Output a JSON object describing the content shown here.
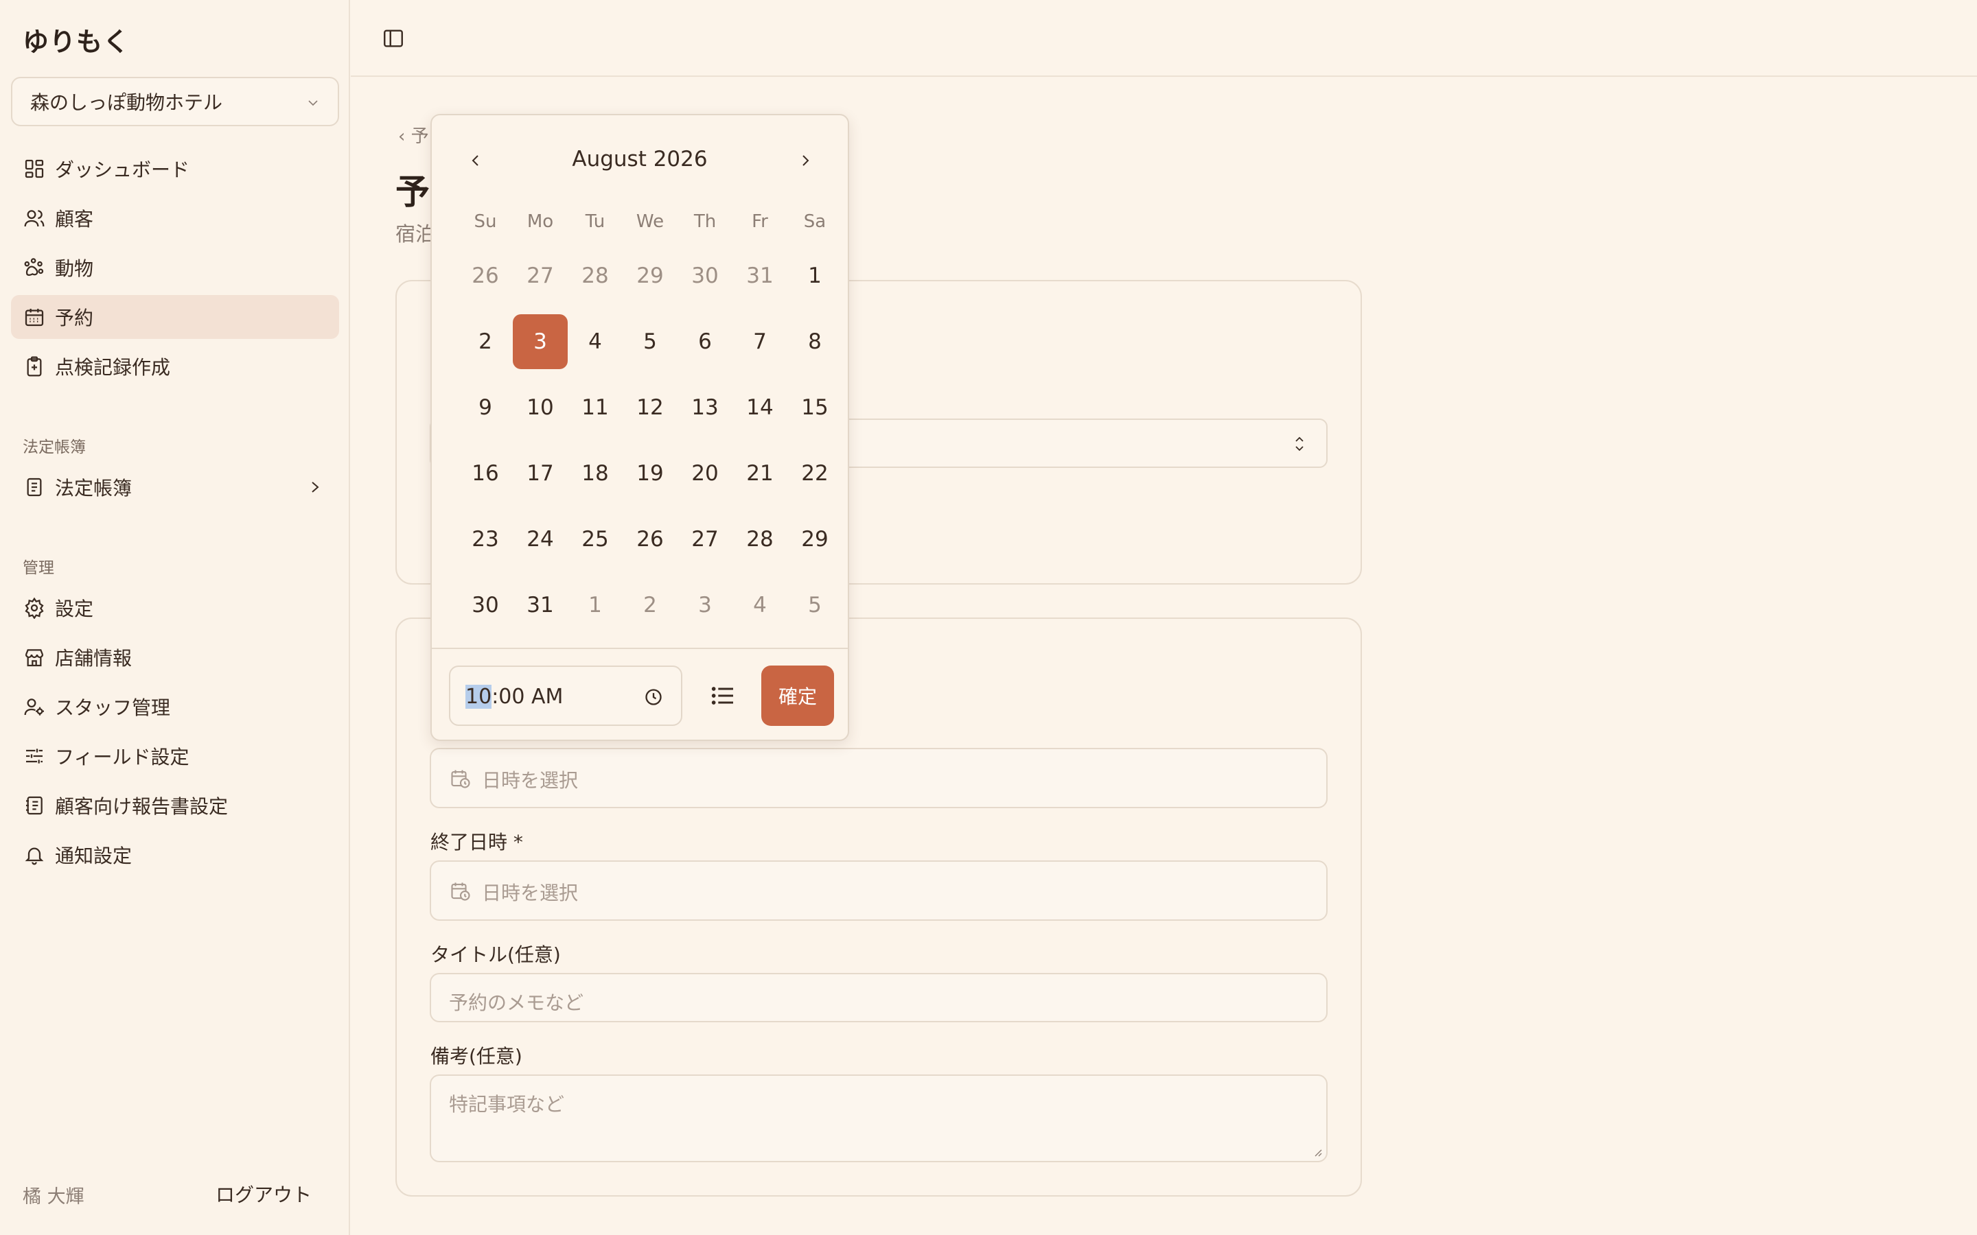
{
  "app": {
    "brand": "ゆりもく"
  },
  "store": {
    "selected": "森のしっぽ動物ホテル"
  },
  "nav": {
    "main": [
      {
        "label": "ダッシュボード",
        "icon": "dashboard-icon"
      },
      {
        "label": "顧客",
        "icon": "users-icon"
      },
      {
        "label": "動物",
        "icon": "paw-icon"
      },
      {
        "label": "予約",
        "icon": "calendar-icon",
        "active": true
      },
      {
        "label": "点検記録作成",
        "icon": "clipboard-icon"
      }
    ],
    "legal_section": "法定帳簿",
    "legal_item": "法定帳簿",
    "admin_section": "管理",
    "admin": [
      {
        "label": "設定",
        "icon": "gear-icon"
      },
      {
        "label": "店舗情報",
        "icon": "store-icon"
      },
      {
        "label": "スタッフ管理",
        "icon": "staff-icon"
      },
      {
        "label": "フィールド設定",
        "icon": "sliders-icon"
      },
      {
        "label": "顧客向け報告書設定",
        "icon": "report-icon"
      },
      {
        "label": "通知設定",
        "icon": "bell-icon"
      }
    ]
  },
  "user": {
    "name": "橘 大輝",
    "logout": "ログアウト"
  },
  "page": {
    "back_partial": "‹ 予",
    "title_partial": "予",
    "subtitle_partial": "宿泊"
  },
  "form": {
    "start_placeholder": "日時を選択",
    "end_label": "終了日時 *",
    "end_placeholder": "日時を選択",
    "title_label": "タイトル(任意)",
    "title_placeholder": "予約のメモなど",
    "notes_label": "備考(任意)",
    "notes_placeholder": "特記事項など"
  },
  "datepicker": {
    "month": "August 2026",
    "weekdays": [
      "Su",
      "Mo",
      "Tu",
      "We",
      "Th",
      "Fr",
      "Sa"
    ],
    "days": [
      {
        "d": "26",
        "out": true
      },
      {
        "d": "27",
        "out": true
      },
      {
        "d": "28",
        "out": true
      },
      {
        "d": "29",
        "out": true
      },
      {
        "d": "30",
        "out": true
      },
      {
        "d": "31",
        "out": true
      },
      {
        "d": "1"
      },
      {
        "d": "2"
      },
      {
        "d": "3",
        "selected": true
      },
      {
        "d": "4"
      },
      {
        "d": "5"
      },
      {
        "d": "6"
      },
      {
        "d": "7"
      },
      {
        "d": "8"
      },
      {
        "d": "9"
      },
      {
        "d": "10"
      },
      {
        "d": "11"
      },
      {
        "d": "12"
      },
      {
        "d": "13"
      },
      {
        "d": "14"
      },
      {
        "d": "15"
      },
      {
        "d": "16"
      },
      {
        "d": "17"
      },
      {
        "d": "18"
      },
      {
        "d": "19"
      },
      {
        "d": "20"
      },
      {
        "d": "21"
      },
      {
        "d": "22"
      },
      {
        "d": "23"
      },
      {
        "d": "24"
      },
      {
        "d": "25"
      },
      {
        "d": "26"
      },
      {
        "d": "27"
      },
      {
        "d": "28"
      },
      {
        "d": "29"
      },
      {
        "d": "30"
      },
      {
        "d": "31"
      },
      {
        "d": "1",
        "out": true
      },
      {
        "d": "2",
        "out": true
      },
      {
        "d": "3",
        "out": true
      },
      {
        "d": "4",
        "out": true
      },
      {
        "d": "5",
        "out": true
      }
    ],
    "time_hour": "10",
    "time_rest": ":00  AM",
    "confirm": "確定"
  },
  "colors": {
    "accent": "#c96543",
    "background": "#fcf4ea",
    "active_nav": "#f3e1d4"
  }
}
